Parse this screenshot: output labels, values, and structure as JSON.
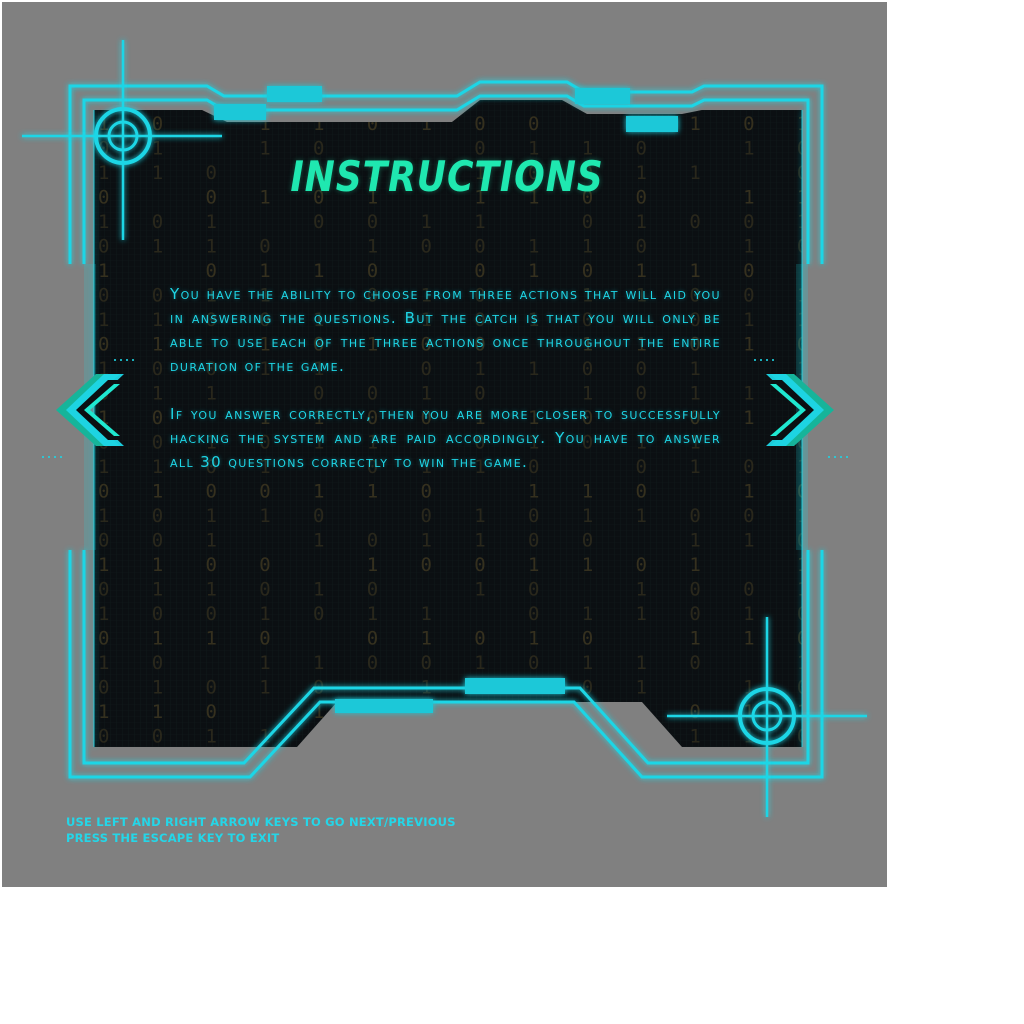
{
  "screen": {
    "title": "INSTRUCTIONS",
    "paragraphs": [
      "You have the ability to choose from three actions that will aid you in answering the questions. But the catch is that you will only be able to use each of the three actions once throughout the entire duration of the game.",
      "If you answer correctly, then you are more closer to successfully hacking the system and are paid accordingly. You have to answer all 30 questions correctly to win the game."
    ]
  },
  "navigation": {
    "previous_icon": "chevron-left-icon",
    "next_icon": "chevron-right-icon"
  },
  "footer": {
    "line1": "USE LEFT AND RIGHT ARROW KEYS TO GO NEXT/PREVIOUS",
    "line2": "PRESS THE ESCAPE KEY TO EXIT"
  },
  "colors": {
    "background": "#808080",
    "panel": "#0b0f12",
    "frame_cyan": "#1ed6e6",
    "title_green": "#1fe8b0",
    "digits_dim": "#3a3420"
  },
  "matrix_rows": [
    "1 0   1 1 0 1 0 0   1 1 0 1",
    "0 1   1 0     0 1 1 0   1 0",
    "1 1 0   0 1   1 0 0 1 1   0",
    "0   0 1 0 1   1 1 0 0   1 1",
    "1 0 1   0 0 1 1   0 1 0 0 1",
    "0 1 1 0   1 0 0 1 1 0   1 0",
    "1   0 1 1 0   0 1 0 1 1 0  ",
    "0 0 1 1   0 1 0   1 1 0 0 1",
    "1 1 0 0 1   1 0 1 0   0 1 1",
    "0 1   1 0 1 0 0   1 1 0 1 0",
    "1 0 0 1 1   0 1 1 0 0 1   1",
    "0 1 1   0 0 1 0   1 0 1 1 0",
    "1 0   1 1 0 0 1 1 0   0 1 1",
    "0 0 1 0 1 1   0 1 0 1 1   0",
    "1 1 0 1   0 1 1 0   0 1 0 1",
    "0 1 0 0 1 1 0   1 1 0   1 0",
    "1 0 1 1 0   0 1 0 1 1 0 0 1",
    "0 0 1   1 0 1 1 0 0   1 1 0",
    "1 1 0 0   1 0 0 1 1 0 1   1",
    "0 1 1 0 1 0   1 0   1 0 0 1",
    "1 0 0 1 0 1 1   0 1 1 0 1 0",
    "0 1 1 0   0 1 0 1 0   1 1 0",
    "1 0   1 1 0 0 1 0 1 1 0   1",
    "0 1 0 1 0   1 1 0 0 1   1 0",
    "1 1 0   1 0 1 0 0 1 1 0 1 1",
    "0 0 1 1 0 1   0 1 0 0 1 1 0"
  ]
}
